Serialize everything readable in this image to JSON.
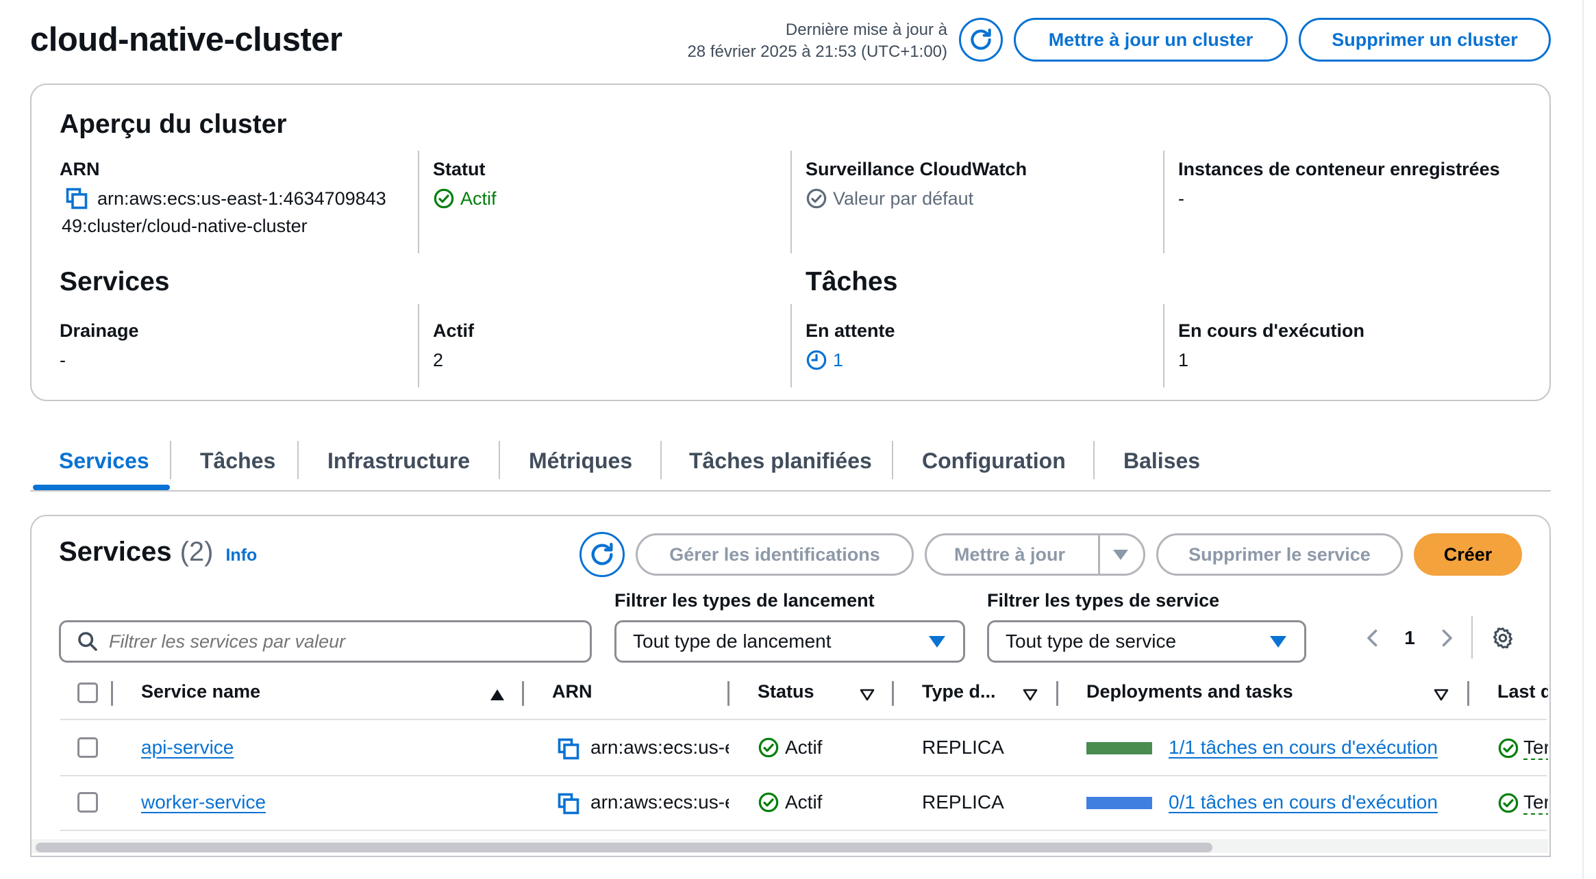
{
  "header": {
    "title": "cloud-native-cluster",
    "last_update_line1": "Dernière mise à jour à",
    "last_update_line2": "28 février 2025 à 21:53 (UTC+1:00)",
    "update_cluster_label": "Mettre à jour un cluster",
    "delete_cluster_label": "Supprimer un cluster"
  },
  "overview": {
    "title": "Aperçu du cluster",
    "arn_label": "ARN",
    "arn_line1": "arn:aws:ecs:us-east-1:4634709843",
    "arn_line2": "49:cluster/cloud-native-cluster",
    "status_label": "Statut",
    "status_value": "Actif",
    "cloudwatch_label": "Surveillance CloudWatch",
    "cloudwatch_value": "Valeur par défaut",
    "instances_label": "Instances de conteneur enregistrées",
    "instances_value": "-",
    "services_title": "Services",
    "draining_label": "Drainage",
    "draining_value": "-",
    "active_label": "Actif",
    "active_value": "2",
    "tasks_title": "Tâches",
    "pending_label": "En attente",
    "pending_value": "1",
    "running_label": "En cours d'exécution",
    "running_value": "1"
  },
  "tabs": [
    {
      "label": "Services"
    },
    {
      "label": "Tâches"
    },
    {
      "label": "Infrastructure"
    },
    {
      "label": "Métriques"
    },
    {
      "label": "Tâches planifiées"
    },
    {
      "label": "Configuration"
    },
    {
      "label": "Balises"
    }
  ],
  "services_panel": {
    "title": "Services",
    "count": "(2)",
    "info_label": "Info",
    "manage_tags_label": "Gérer les identifications",
    "update_label": "Mettre à jour",
    "delete_service_label": "Supprimer le service",
    "create_label": "Créer",
    "launch_filter_label": "Filtrer les types de lancement",
    "service_filter_label": "Filtrer les types de service",
    "search_placeholder": "Filtrer les services par valeur",
    "launch_select_value": "Tout type de lancement",
    "service_select_value": "Tout type de service",
    "page_number": "1"
  },
  "table": {
    "columns": [
      "Service name",
      "ARN",
      "Status",
      "Type d...",
      "Deployments and tasks",
      "Last d"
    ],
    "rows": [
      {
        "name": "api-service",
        "arn": "arn:aws:ecs:us-e",
        "status": "Actif",
        "type": "REPLICA",
        "tasks": "1/1 tâches en cours d'exécution",
        "tasks_fraction": 1.0,
        "bar_color": "#4a8c4f",
        "last": "Ter"
      },
      {
        "name": "worker-service",
        "arn": "arn:aws:ecs:us-e",
        "status": "Actif",
        "type": "REPLICA",
        "tasks": "0/1 tâches en cours d'exécution",
        "tasks_fraction": 0.0,
        "bar_color": "#3f7fe0",
        "last": "Ter"
      }
    ]
  },
  "colors": {
    "accent": "#0972d3",
    "success": "#037f0c",
    "primary_button": "#f3a23c"
  }
}
